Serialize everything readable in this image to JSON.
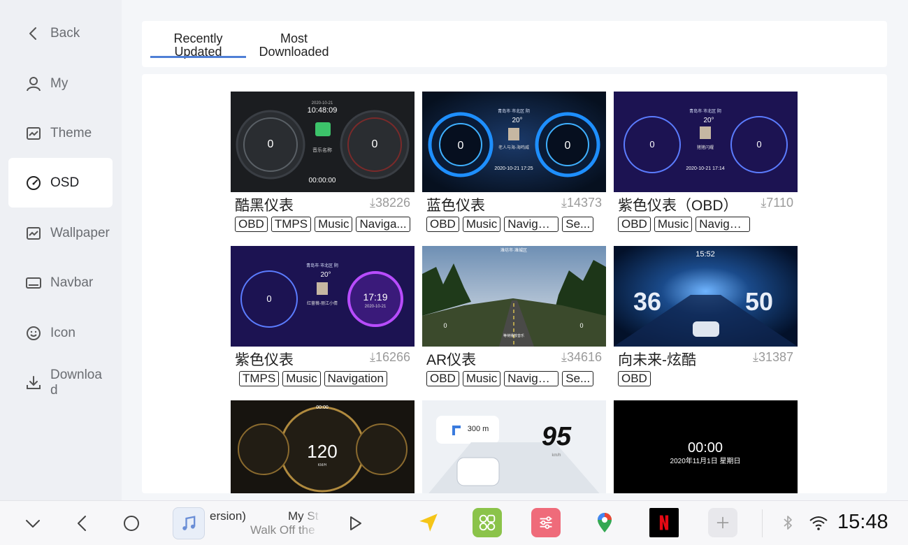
{
  "sidebar": {
    "items": [
      {
        "label": "Back",
        "icon": "back-chevron-icon"
      },
      {
        "label": "My",
        "icon": "person-icon"
      },
      {
        "label": "Theme",
        "icon": "image-icon"
      },
      {
        "label": "OSD",
        "icon": "gauge-icon",
        "active": true
      },
      {
        "label": "Wallpaper",
        "icon": "image-icon"
      },
      {
        "label": "Navbar",
        "icon": "navbar-icon"
      },
      {
        "label": "Icon",
        "icon": "smiley-icon"
      },
      {
        "label": "Download",
        "icon": "download-icon"
      }
    ]
  },
  "tabs": [
    {
      "label": "Recently Updated",
      "active": true
    },
    {
      "label": "Most Downloaded",
      "active": false
    }
  ],
  "cards": [
    {
      "name": "酷黑仪表",
      "downloads": "⤓38226",
      "tags": [
        "OBD",
        "TMPS",
        "Music",
        "Naviga..."
      ]
    },
    {
      "name": "蓝色仪表",
      "downloads": "⤓14373",
      "tags": [
        "OBD",
        "Music",
        "Navigation",
        "Se..."
      ]
    },
    {
      "name": "紫色仪表（OBD）",
      "downloads": "⤓7110",
      "tags": [
        "OBD",
        "Music",
        "Navigation"
      ]
    },
    {
      "name": "紫色仪表",
      "downloads": "⤓16266",
      "tags": [
        "TMPS",
        "Music",
        "Navigation"
      ]
    },
    {
      "name": "AR仪表",
      "downloads": "⤓34616",
      "tags": [
        "OBD",
        "Music",
        "Navigation",
        "Se..."
      ]
    },
    {
      "name": "向未来-炫酷",
      "downloads": "⤓31387",
      "tags": [
        "OBD"
      ]
    },
    {
      "name": "",
      "downloads": "",
      "tags": []
    },
    {
      "name": "",
      "downloads": "",
      "tags": []
    },
    {
      "name": "",
      "downloads": "",
      "tags": []
    }
  ],
  "thumbs": {
    "t1": {
      "date": "2020-10-21",
      "time": "10:48:09",
      "left": "0",
      "right": "0",
      "song": "音乐名称",
      "clock": "00:00:00"
    },
    "t2": {
      "city": "青岛市·市北区 阴",
      "temp": "20°",
      "left": "0",
      "right": "0",
      "song": "老人与海-海鸣威",
      "stamp": "2020-10-21 17:25"
    },
    "t3": {
      "city": "青岛市·市北区 阴",
      "temp": "20°",
      "left": "0",
      "right": "0",
      "song": "猪猪闪耀",
      "stamp": "2020-10-21 17:14"
    },
    "t4": {
      "city": "青岛市·市北区 阴",
      "temp": "20°",
      "left": "0",
      "time": "17:19",
      "date": "2020-10-21",
      "song": "红蔷薇-丽江小倩"
    },
    "t5": {
      "city": "潍坊市·潍城区",
      "left": "0",
      "right": "0",
      "footer": "等待播放音乐"
    },
    "t6": {
      "time": "15:52",
      "left": "36",
      "right": "50"
    },
    "t7": {
      "clock": "00:00",
      "speed": "120",
      "unit": "KM/H"
    },
    "t8": {
      "distance": "300 m",
      "speed": "95",
      "unit": "km/h"
    },
    "t9": {
      "time": "00:00",
      "date": "2020年11月1日 星期日"
    }
  },
  "bottombar": {
    "music": {
      "line1a": "ersion)",
      "line1b": "My St",
      "line2": "Walk Off the"
    },
    "clock": "15:48"
  },
  "colors": {
    "accent": "#4f7fd6",
    "active_bg": "#ffffff"
  }
}
